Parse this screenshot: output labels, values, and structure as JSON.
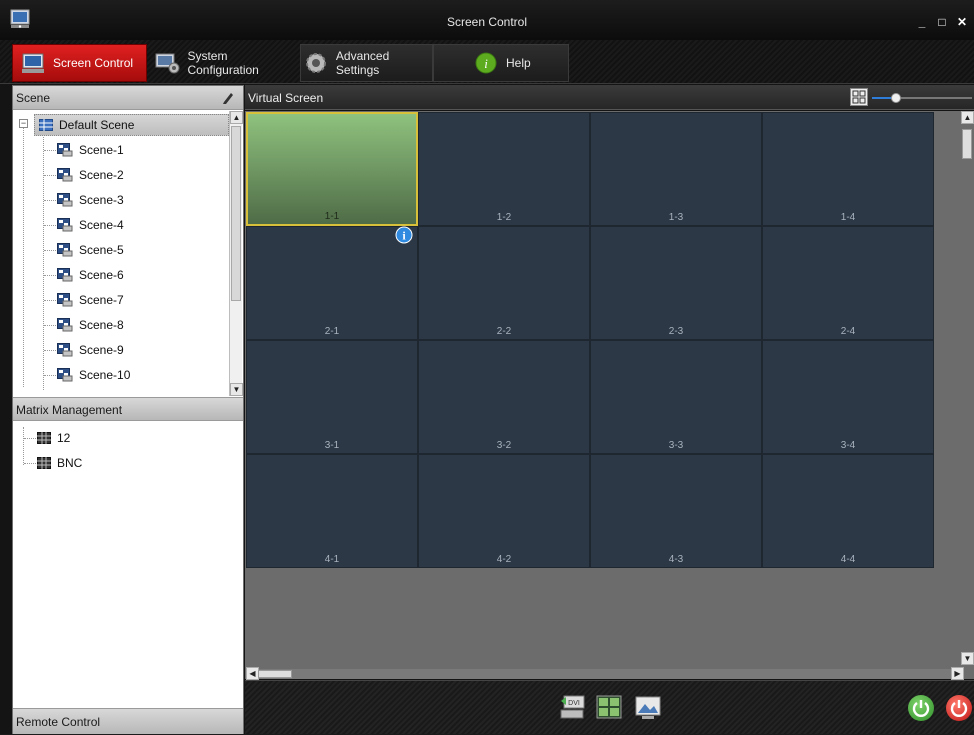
{
  "window": {
    "title": "Screen Control",
    "minimize": "_",
    "maximize": "□",
    "close": "✕"
  },
  "tabs": [
    {
      "label": "Screen Control",
      "icon": "monitor-icon",
      "active": true
    },
    {
      "label": "System Configuration",
      "icon": "monitor-gear-icon",
      "active": false
    },
    {
      "label": "Advanced Settings",
      "icon": "gear-icon",
      "active": false
    },
    {
      "label": "Help",
      "icon": "info-icon",
      "active": false
    }
  ],
  "scene_panel": {
    "header": "Scene",
    "root": "Default Scene",
    "items": [
      "Scene-1",
      "Scene-2",
      "Scene-3",
      "Scene-4",
      "Scene-5",
      "Scene-6",
      "Scene-7",
      "Scene-8",
      "Scene-9",
      "Scene-10"
    ]
  },
  "matrix_panel": {
    "header": "Matrix Management",
    "items": [
      "12",
      "BNC"
    ]
  },
  "remote_panel": {
    "header": "Remote Control"
  },
  "virtual_screen": {
    "title": "Virtual Screen",
    "zoom_level": 0.2,
    "cells": [
      [
        "1-1",
        "1-2",
        "1-3",
        "1-4"
      ],
      [
        "2-1",
        "2-2",
        "2-3",
        "2-4"
      ],
      [
        "3-1",
        "3-2",
        "3-3",
        "3-4"
      ],
      [
        "4-1",
        "4-2",
        "4-3",
        "4-4"
      ]
    ],
    "selected_cell": "1-1"
  },
  "toolbar": {
    "tools": [
      "dvi-keyboard-icon",
      "layout-split-icon",
      "image-background-icon"
    ],
    "power_on_color": "#3fa33a",
    "power_off_color": "#d42222"
  },
  "colors": {
    "accent": "#d01818",
    "cell_bg": "#2c3846",
    "selected_cell": "#8fc27e"
  }
}
